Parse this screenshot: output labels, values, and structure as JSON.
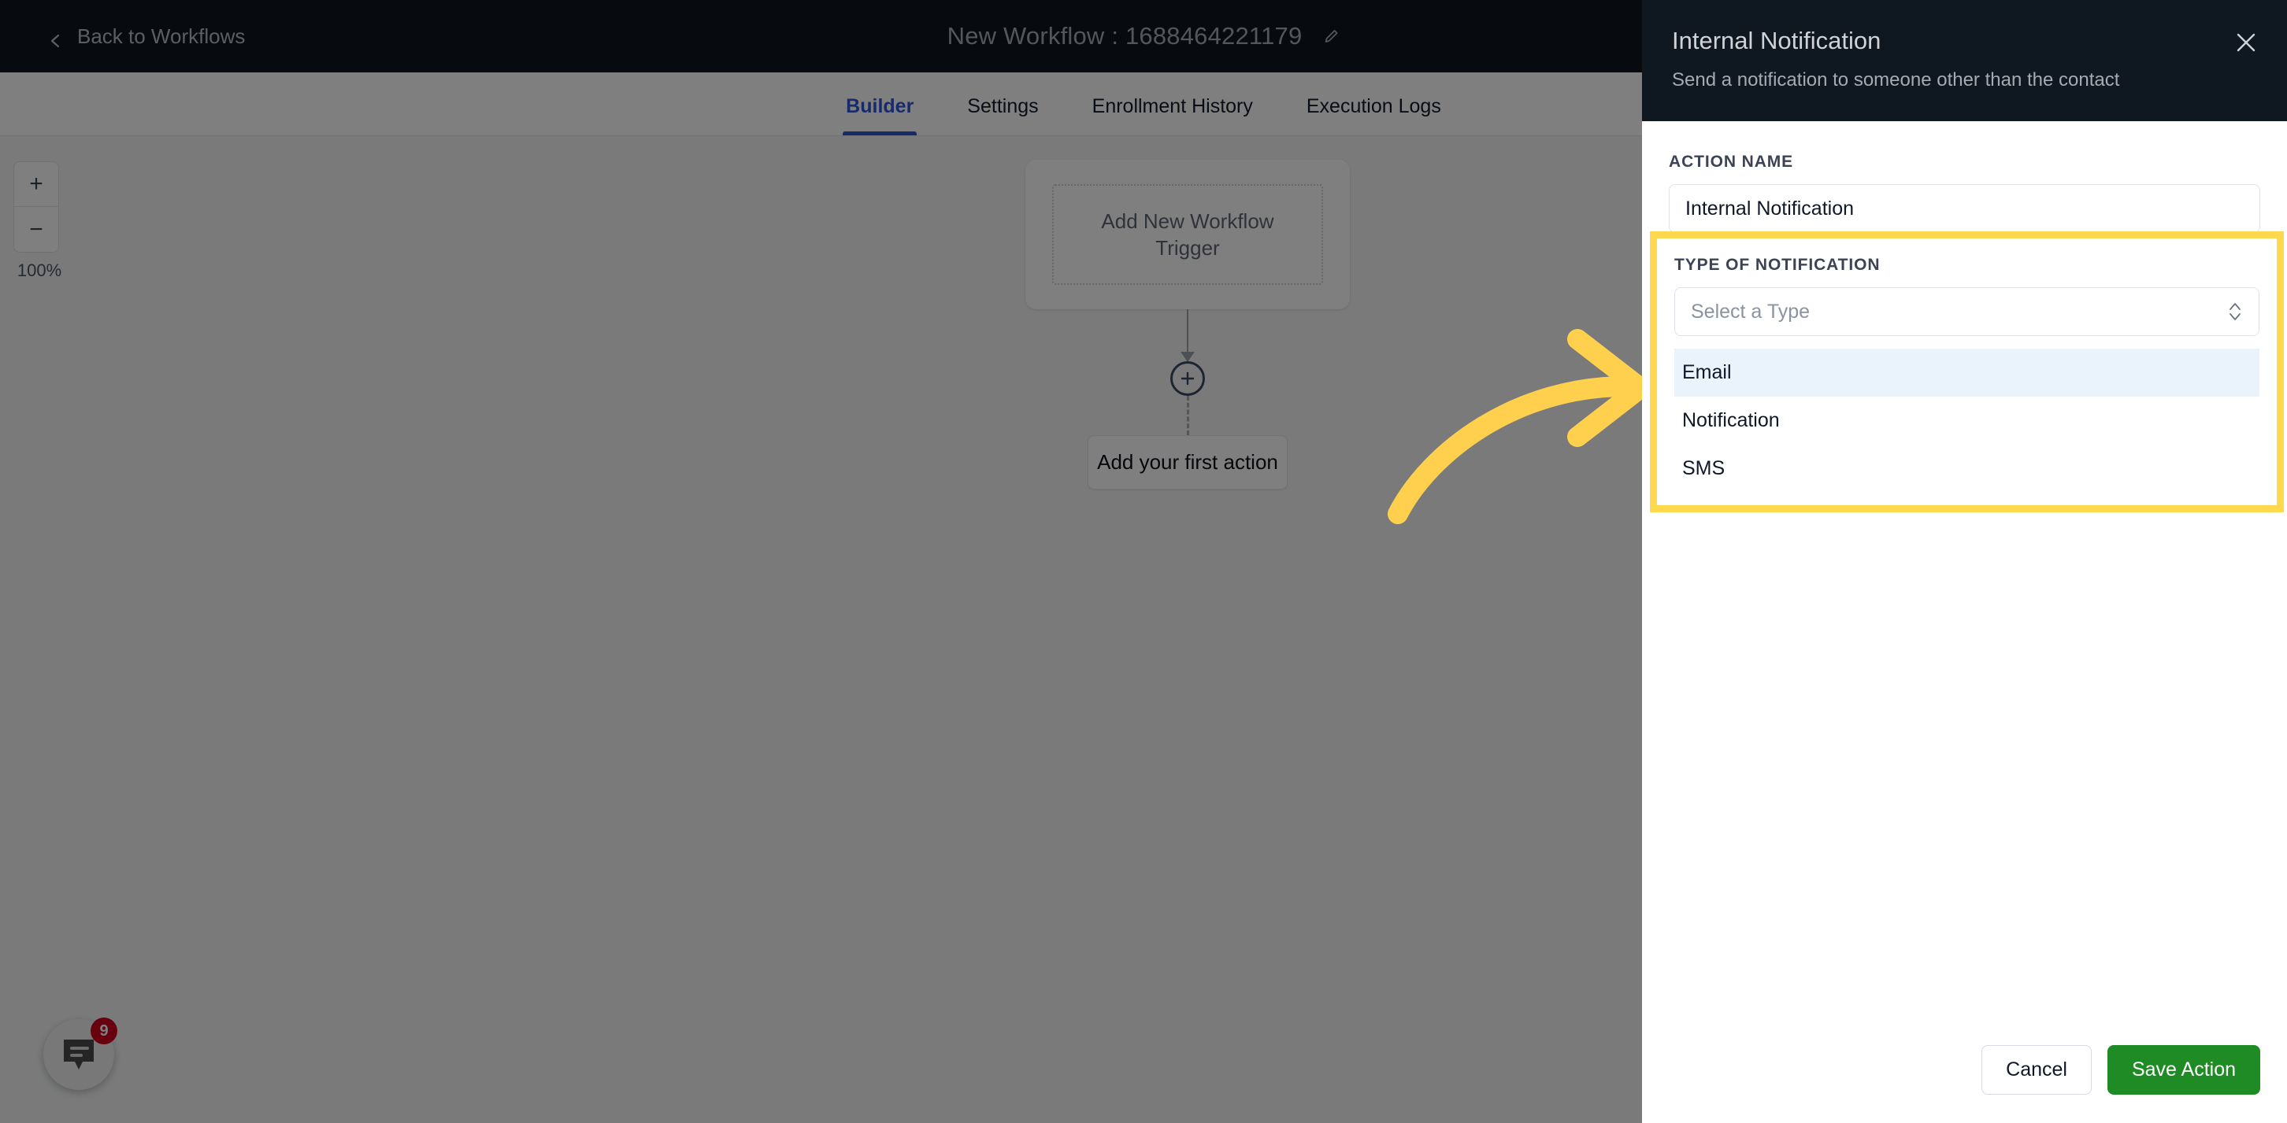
{
  "topbar": {
    "back_label": "Back to Workflows",
    "back_icon": "chevron-left-icon",
    "workflow_title": "New Workflow : 1688464221179",
    "edit_icon": "pencil-icon"
  },
  "tabs": [
    {
      "label": "Builder",
      "active": true
    },
    {
      "label": "Settings",
      "active": false
    },
    {
      "label": "Enrollment History",
      "active": false
    },
    {
      "label": "Execution Logs",
      "active": false
    }
  ],
  "canvas": {
    "zoom": {
      "in_label": "+",
      "out_label": "−",
      "level": "100%"
    },
    "trigger_card_label": "Add New Workflow Trigger",
    "add_node_icon": "plus-circle-icon",
    "first_action_label": "Add your first action"
  },
  "chat_widget": {
    "icon": "chat-bubble-icon",
    "unread_count": "9"
  },
  "panel": {
    "title": "Internal Notification",
    "subtitle": "Send a notification to someone other than the contact",
    "close_icon": "close-icon",
    "action_name": {
      "label": "ACTION NAME",
      "value": "Internal Notification"
    },
    "notification_type": {
      "label": "TYPE OF NOTIFICATION",
      "placeholder": "Select a Type",
      "selected": "",
      "dropdown_icon": "chevron-up-down-icon",
      "options": [
        {
          "label": "Email",
          "highlighted": true
        },
        {
          "label": "Notification",
          "highlighted": false
        },
        {
          "label": "SMS",
          "highlighted": false
        }
      ]
    },
    "footer": {
      "cancel_label": "Cancel",
      "save_label": "Save Action"
    }
  },
  "annotation": {
    "arrow_icon": "curved-arrow-right-icon",
    "arrow_color": "#ffd04d",
    "highlight_color": "#ffd84d"
  },
  "colors": {
    "accent_blue": "#2f55d4",
    "save_green": "#1f8b24",
    "header_dark": "#0f1720",
    "badge_red": "#d0021b"
  }
}
